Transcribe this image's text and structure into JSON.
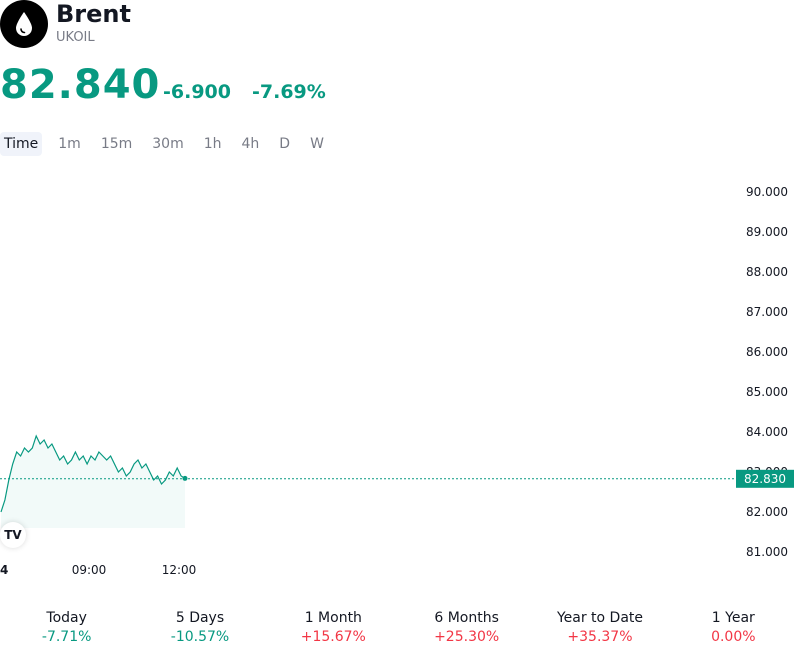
{
  "header": {
    "title": "Brent",
    "ticker": "UKOIL",
    "logo_icon": "oil-drop-icon",
    "price": "82.840",
    "change": "-6.900",
    "change_percent": "-7.69%"
  },
  "colors": {
    "up": "#089981",
    "down": "#f23645",
    "text": "#131722",
    "muted": "#787b86"
  },
  "tabs": [
    {
      "label": "Time"
    },
    {
      "label": "1m"
    },
    {
      "label": "15m"
    },
    {
      "label": "30m"
    },
    {
      "label": "1h"
    },
    {
      "label": "4h"
    },
    {
      "label": "D"
    },
    {
      "label": "W"
    }
  ],
  "chart_data": {
    "type": "area",
    "ylim": [
      81,
      90
    ],
    "y_ticks": [
      "90.000",
      "89.000",
      "88.000",
      "87.000",
      "86.000",
      "85.000",
      "84.000",
      "83.000",
      "82.000",
      "81.000"
    ],
    "x_ticks": [
      "4",
      "09:00",
      "12:00"
    ],
    "current_value": "82.830",
    "series": [
      {
        "values": [
          82.0,
          82.3,
          82.8,
          83.2,
          83.5,
          83.4,
          83.6,
          83.5,
          83.6,
          83.9,
          83.7,
          83.8,
          83.6,
          83.7,
          83.5,
          83.3,
          83.4,
          83.2,
          83.3,
          83.5,
          83.3,
          83.4,
          83.2,
          83.4,
          83.3,
          83.5,
          83.4,
          83.3,
          83.4,
          83.2,
          83.0,
          83.1,
          82.9,
          83.0,
          83.2,
          83.3,
          83.1,
          83.2,
          83.0,
          82.8,
          82.9,
          82.7,
          82.8,
          83.0,
          82.9,
          83.1,
          82.9,
          82.84
        ]
      }
    ]
  },
  "performance": [
    {
      "label": "Today",
      "value": "-7.71%",
      "color": "#089981"
    },
    {
      "label": "5 Days",
      "value": "-10.57%",
      "color": "#089981"
    },
    {
      "label": "1 Month",
      "value": "+15.67%",
      "color": "#f23645"
    },
    {
      "label": "6 Months",
      "value": "+25.30%",
      "color": "#f23645"
    },
    {
      "label": "Year to Date",
      "value": "+35.37%",
      "color": "#f23645"
    },
    {
      "label": "1 Year",
      "value": "0.00%",
      "color": "#f23645"
    }
  ]
}
